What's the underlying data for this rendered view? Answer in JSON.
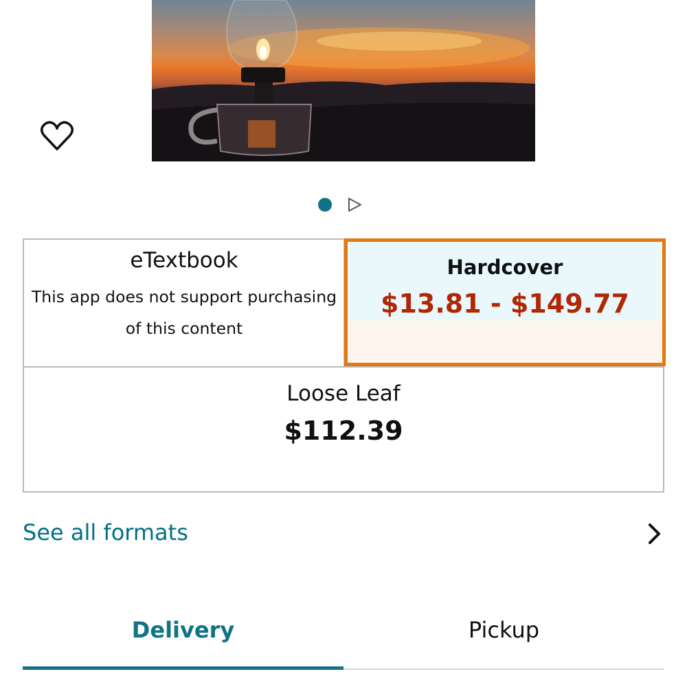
{
  "product": {
    "image_alt": "",
    "icons": {
      "wishlist": "heart-outline-icon",
      "carousel_next": "play-triangle-icon",
      "see_all_chevron": "chevron-right-icon"
    }
  },
  "carousel": {
    "active_index": 1,
    "total": 2
  },
  "formats": {
    "etextbook": {
      "name": "eTextbook",
      "note_line1": "This app does not support purchasing",
      "note_line2": "of this content"
    },
    "hardcover": {
      "name": "Hardcover",
      "price": "$13.81 - $149.77",
      "selected": true
    },
    "loose_leaf": {
      "name": "Loose Leaf",
      "price": "$112.39"
    }
  },
  "see_all_formats": {
    "label": "See all formats"
  },
  "tabs": [
    {
      "label": "Delivery",
      "active": true
    },
    {
      "label": "Pickup",
      "active": false
    }
  ],
  "colors": {
    "accent_teal": "#127287",
    "link_teal": "#007185",
    "selected_border": "#e47911",
    "price_red": "#b12704",
    "selected_bg_top": "#eaf8fb",
    "selected_bg_bottom": "#fef5ee"
  }
}
